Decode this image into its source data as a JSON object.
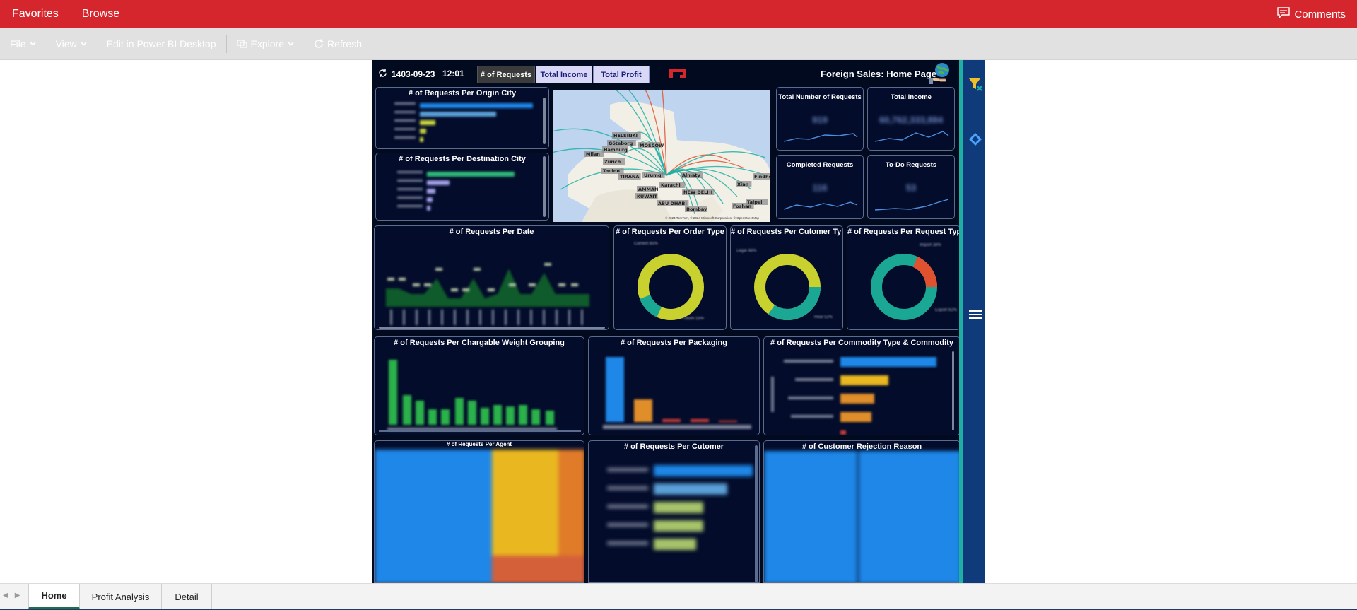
{
  "topbar": {
    "favorites": "Favorites",
    "browse": "Browse",
    "comments": "Comments"
  },
  "toolbar": {
    "file": "File",
    "view": "View",
    "edit": "Edit in Power BI Desktop",
    "explore": "Explore",
    "refresh": "Refresh"
  },
  "report": {
    "date": "1403-09-23",
    "time": "12:01",
    "toggles": [
      "# of Requests",
      "Total Income",
      "Total Profit"
    ],
    "page_title": "Foreign Sales: Home Page",
    "visuals": {
      "origin_city": "# of Requests Per Origin City",
      "destination_city": "# of Requests Per Destination City",
      "kpi_total_requests": "Total Number of Requests",
      "kpi_total_income": "Total Income",
      "kpi_completed": "Completed Requests",
      "kpi_todo": "To-Do Requests",
      "per_date": "# of Requests Per Date",
      "per_order_type": "# of Requests Per Order Type",
      "per_customer_type": "# of Requests Per Cutomer Type",
      "per_request_type": "# of Requests Per Request Type",
      "per_weight": "# of Requests Per Chargable Weight Grouping",
      "per_packaging": "# of Requests Per Packaging",
      "per_commodity": "# of Requests Per Commodity Type & Commodity",
      "per_agent": "# of Requests Per Agent",
      "per_customer": "# of Requests Per Cutomer",
      "rejection": "# of Customer Rejection Reason"
    },
    "map_cities": [
      "HELSINKI",
      "Göteborg",
      "Hamburg",
      "MOSCOW",
      "Milan",
      "Zurich",
      "Toulon",
      "TIRANA",
      "Almaty",
      "Urumqi",
      "Karachi",
      "NEW DELHI",
      "Bombay",
      "ABU DHABI",
      "KUWAIT",
      "AMMAN",
      "Xian",
      "Foshan",
      "Taipei",
      "Findhow"
    ],
    "map_attribution": "© 2024 TomTom, © 2024 Microsoft Corporation, © OpenStreetMap",
    "kpi_values": {
      "total_requests": "919",
      "total_income": "60,762,333,884",
      "completed": "116",
      "todo": "53"
    }
  },
  "sheets": [
    "Home",
    "Profit Analysis",
    "Detail"
  ],
  "colors": {
    "brand_red": "#d6262d",
    "canvas_bg": "#010a1f",
    "accent_teal": "#1fb0a4",
    "sidebar_blue": "#0f3b7a"
  }
}
